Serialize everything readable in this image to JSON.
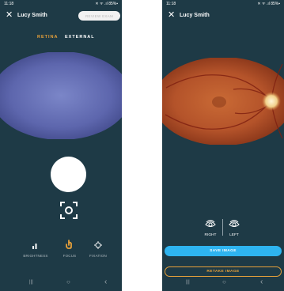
{
  "colors": {
    "screen_bg": "#1e3a46",
    "accent_orange": "#e8a13a",
    "accent_blue": "#2eb4f0"
  },
  "capture_screen": {
    "status": {
      "time": "11:18",
      "icons": "✕ ᯤ .ıl 85%▪"
    },
    "header": {
      "close_icon": "✕",
      "patient_name": "Lucy Smith",
      "review_button": "REVIEW EXAM"
    },
    "tabs": [
      {
        "label": "RETINA",
        "active": true
      },
      {
        "label": "EXTERNAL",
        "active": false
      }
    ],
    "tools": [
      {
        "label": "BRIGHTNESS",
        "icon": "brightness-bars-icon"
      },
      {
        "label": "FOCUS",
        "icon": "focus-hand-icon"
      },
      {
        "label": "FIXATION",
        "icon": "fixation-icon"
      }
    ],
    "navbar": {
      "recent": "|||",
      "home": "○",
      "back": "‹"
    }
  },
  "review_screen": {
    "status": {
      "time": "11:18",
      "icons": "✕ ᯤ .ıl 85%▪"
    },
    "header": {
      "close_icon": "✕",
      "patient_name": "Lucy Smith"
    },
    "eye_selector": {
      "right_label": "RIGHT",
      "left_label": "LEFT"
    },
    "save_button": "SAVE IMAGE",
    "retake_button": "RETAKE IMAGE",
    "navbar": {
      "recent": "|||",
      "home": "○",
      "back": "‹"
    }
  }
}
